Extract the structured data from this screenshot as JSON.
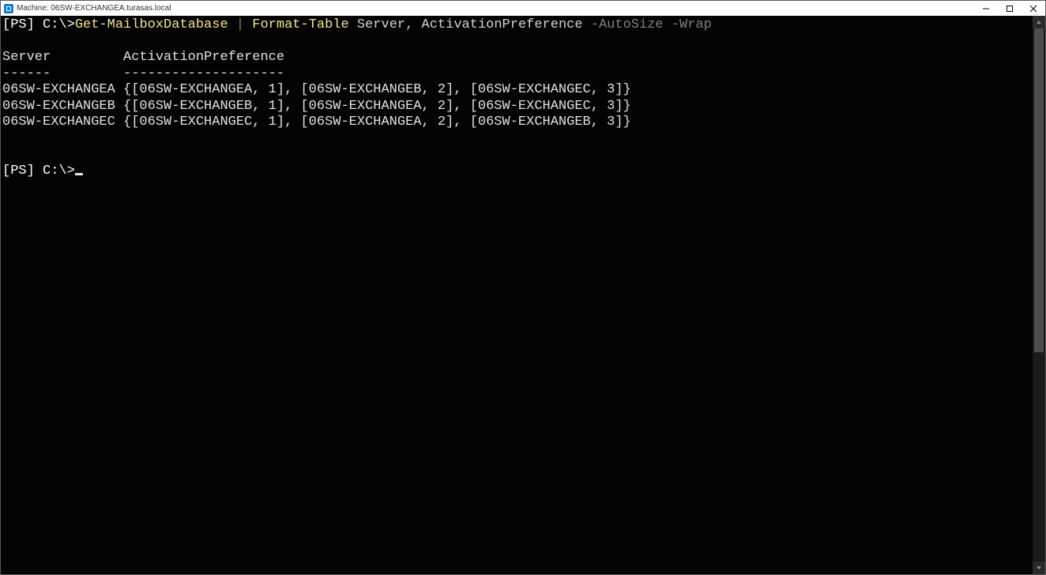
{
  "window": {
    "title": "Machine: 06SW-EXCHANGEA.turasas.local"
  },
  "terminal": {
    "prompt_parts": {
      "ps_open": "[PS]",
      "space1": " ",
      "path": "C:\\>"
    },
    "command": {
      "cmdlet1": "Get-MailboxDatabase",
      "pipe": " | ",
      "cmdlet2": "Format-Table",
      "space_after_ft": " ",
      "param1": "Server",
      "comma": ", ",
      "param2": "ActivationPreference",
      "space_before_sw": " ",
      "switch1": "-AutoSize",
      "space_mid_sw": " ",
      "switch2": "-Wrap"
    },
    "blank_after_command": "",
    "blank_after_command2": "",
    "headers": {
      "server": "Server",
      "gap": "         ",
      "actpref": "ActivationPreference"
    },
    "underlines": {
      "server": "------",
      "gap": "         ",
      "actpref": "--------------------"
    },
    "rows": [
      {
        "server": "06SW-EXCHANGEA",
        "actpref": "{[06SW-EXCHANGEA, 1], [06SW-EXCHANGEB, 2], [06SW-EXCHANGEC, 3]}"
      },
      {
        "server": "06SW-EXCHANGEB",
        "actpref": "{[06SW-EXCHANGEB, 1], [06SW-EXCHANGEA, 2], [06SW-EXCHANGEC, 3]}"
      },
      {
        "server": "06SW-EXCHANGEC",
        "actpref": "{[06SW-EXCHANGEC, 1], [06SW-EXCHANGEA, 2], [06SW-EXCHANGEB, 3]}"
      }
    ],
    "blank_after_rows1": "",
    "blank_after_rows2": "",
    "ready_prompt": {
      "ps_open": "[PS]",
      "space1": " ",
      "path": "C:\\>"
    }
  }
}
